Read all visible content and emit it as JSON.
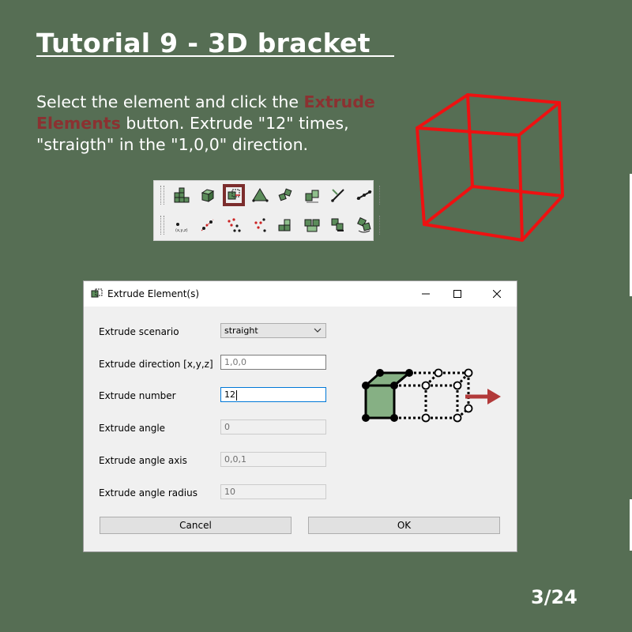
{
  "page": {
    "title": "Tutorial 9 - 3D bracket",
    "instructions": {
      "part1": "Select the element and click the ",
      "highlight": "Extrude Elements",
      "part2": " button. Extrude \"12\" times, \"straigth\" in the \"1,0,0\" direction."
    },
    "page_number": "3/24",
    "colors": {
      "background": "#566e54",
      "highlight": "#8b3131",
      "cube": "#ee1111",
      "accent": "#7c2d2d"
    }
  },
  "toolbar": {
    "row1_icons": [
      "mesh-grid-icon",
      "box-element-icon",
      "extrude-elements-icon",
      "revolve-icon",
      "sweep-icon",
      "copy-elements-icon",
      "line-tool-icon",
      "node-line-icon"
    ],
    "row2_icons": [
      "coordinate-node-icon",
      "node-pair-icon",
      "node-cloud-icon",
      "nodes-move-icon",
      "elements-group-icon",
      "elements-split-icon",
      "elements-move-icon",
      "elements-rotate-icon"
    ],
    "active_button": "Extrude Elements"
  },
  "dialog": {
    "title": "Extrude Element(s)",
    "fields": [
      {
        "label": "Extrude scenario",
        "value": "straight"
      },
      {
        "label": "Extrude direction [x,y,z]",
        "value": "1,0,0"
      },
      {
        "label": "Extrude number",
        "value": "12"
      },
      {
        "label": "Extrude angle",
        "value": "0"
      },
      {
        "label": "Extrude angle axis",
        "value": "0,0,1"
      },
      {
        "label": "Extrude angle radius",
        "value": "10"
      }
    ],
    "cancel_label": "Cancel",
    "ok_label": "OK"
  }
}
